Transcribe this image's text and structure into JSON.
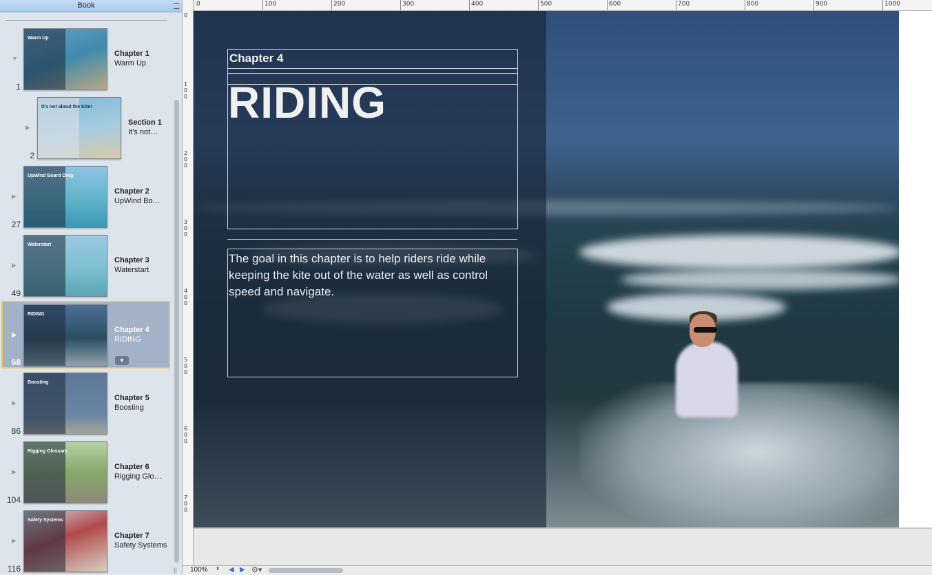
{
  "sidebar": {
    "title": "Book",
    "items": [
      {
        "page": "1",
        "label1": "Chapter 1",
        "label2": "Warm Up",
        "thumb_title": "Warm Up",
        "disclosure": "▼"
      },
      {
        "page": "2",
        "label1": "Section 1",
        "label2": "It’s not…",
        "thumb_title": "It's not about the Kite!",
        "disclosure": "▶"
      },
      {
        "page": "27",
        "label1": "Chapter 2",
        "label2": "UpWind  Bo…",
        "thumb_title": "UpWind  Board Drag",
        "disclosure": "▶"
      },
      {
        "page": "49",
        "label1": "Chapter 3",
        "label2": "Waterstart",
        "thumb_title": "Waterstart",
        "disclosure": "▶"
      },
      {
        "page": "68",
        "label1": "Chapter 4",
        "label2": "RIDING",
        "thumb_title": "RIDING",
        "disclosure": "▶",
        "menu": "▼"
      },
      {
        "page": "86",
        "label1": "Chapter 5",
        "label2": "Boosting",
        "thumb_title": "Boosting",
        "disclosure": "▶"
      },
      {
        "page": "104",
        "label1": "Chapter 6",
        "label2": "Rigging Glo…",
        "thumb_title": "Rigging Glossary",
        "disclosure": "▶"
      },
      {
        "page": "116",
        "label1": "Chapter 7",
        "label2": "Safety Systems",
        "thumb_title": "Safety Systems",
        "disclosure": "▶"
      }
    ]
  },
  "ruler": {
    "top": [
      "0",
      "100",
      "200",
      "300",
      "400",
      "500",
      "600",
      "700",
      "800",
      "900",
      "1000"
    ],
    "left": [
      "0",
      "100",
      "200",
      "300",
      "400",
      "500",
      "600",
      "700"
    ]
  },
  "page": {
    "chapter_label": "Chapter 4",
    "chapter_title": "RIDING",
    "description": "The goal in this chapter is to help riders ride while keeping the kite out of the water as well as control speed and navigate."
  },
  "bottom": {
    "zoom": "100%",
    "zoom_arrows": "⬍",
    "prev": "◀",
    "next": "▶",
    "gear": "⚙▾",
    "grip": "||"
  },
  "colors": {
    "selection_border": "#f2c44a",
    "sidebar_bg": "#dde4ec",
    "accent": "#3b6ec9"
  }
}
